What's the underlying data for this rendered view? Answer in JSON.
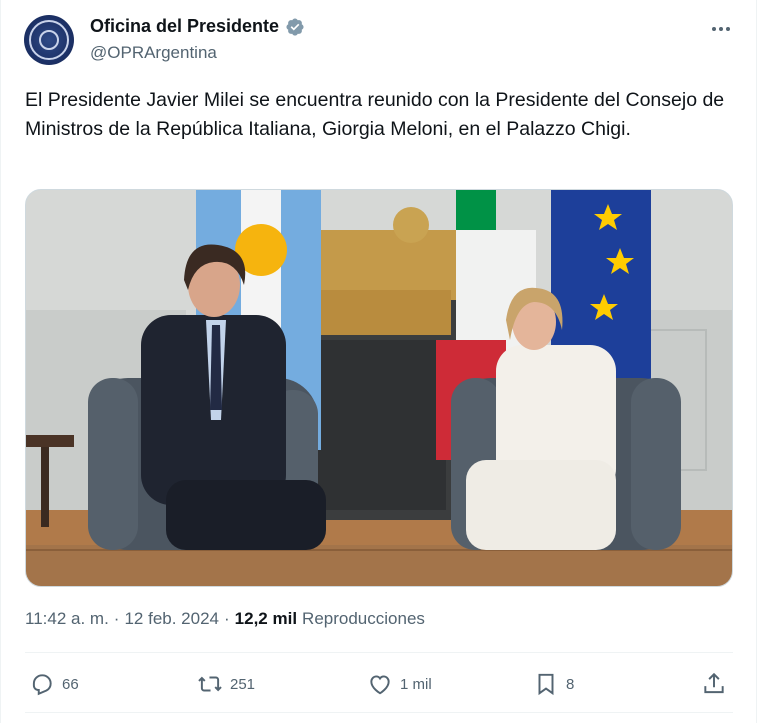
{
  "author": {
    "display_name": "Oficina del Presidente",
    "handle": "@OPRArgentina",
    "avatar_icon": "presidential-seal-icon",
    "verified_icon": "verified-badge-icon",
    "verified_color": "#829aab"
  },
  "tweet": {
    "text": "El Presidente Javier Milei se encuentra reunido con la Presidente del Consejo de Ministros de la República Italiana, Giorgia Meloni, en el Palazzo Chigi.",
    "time": "11:42 a. m.",
    "separator": "·",
    "date": "12 feb. 2024",
    "views_count": "12,2 mil",
    "views_label": "Reproducciones"
  },
  "actions": {
    "replies": "66",
    "reposts": "251",
    "likes": "1 mil",
    "bookmarks": "8"
  },
  "colors": {
    "text": "#0f1419",
    "secondary": "#536471",
    "border": "#eff3f4"
  }
}
